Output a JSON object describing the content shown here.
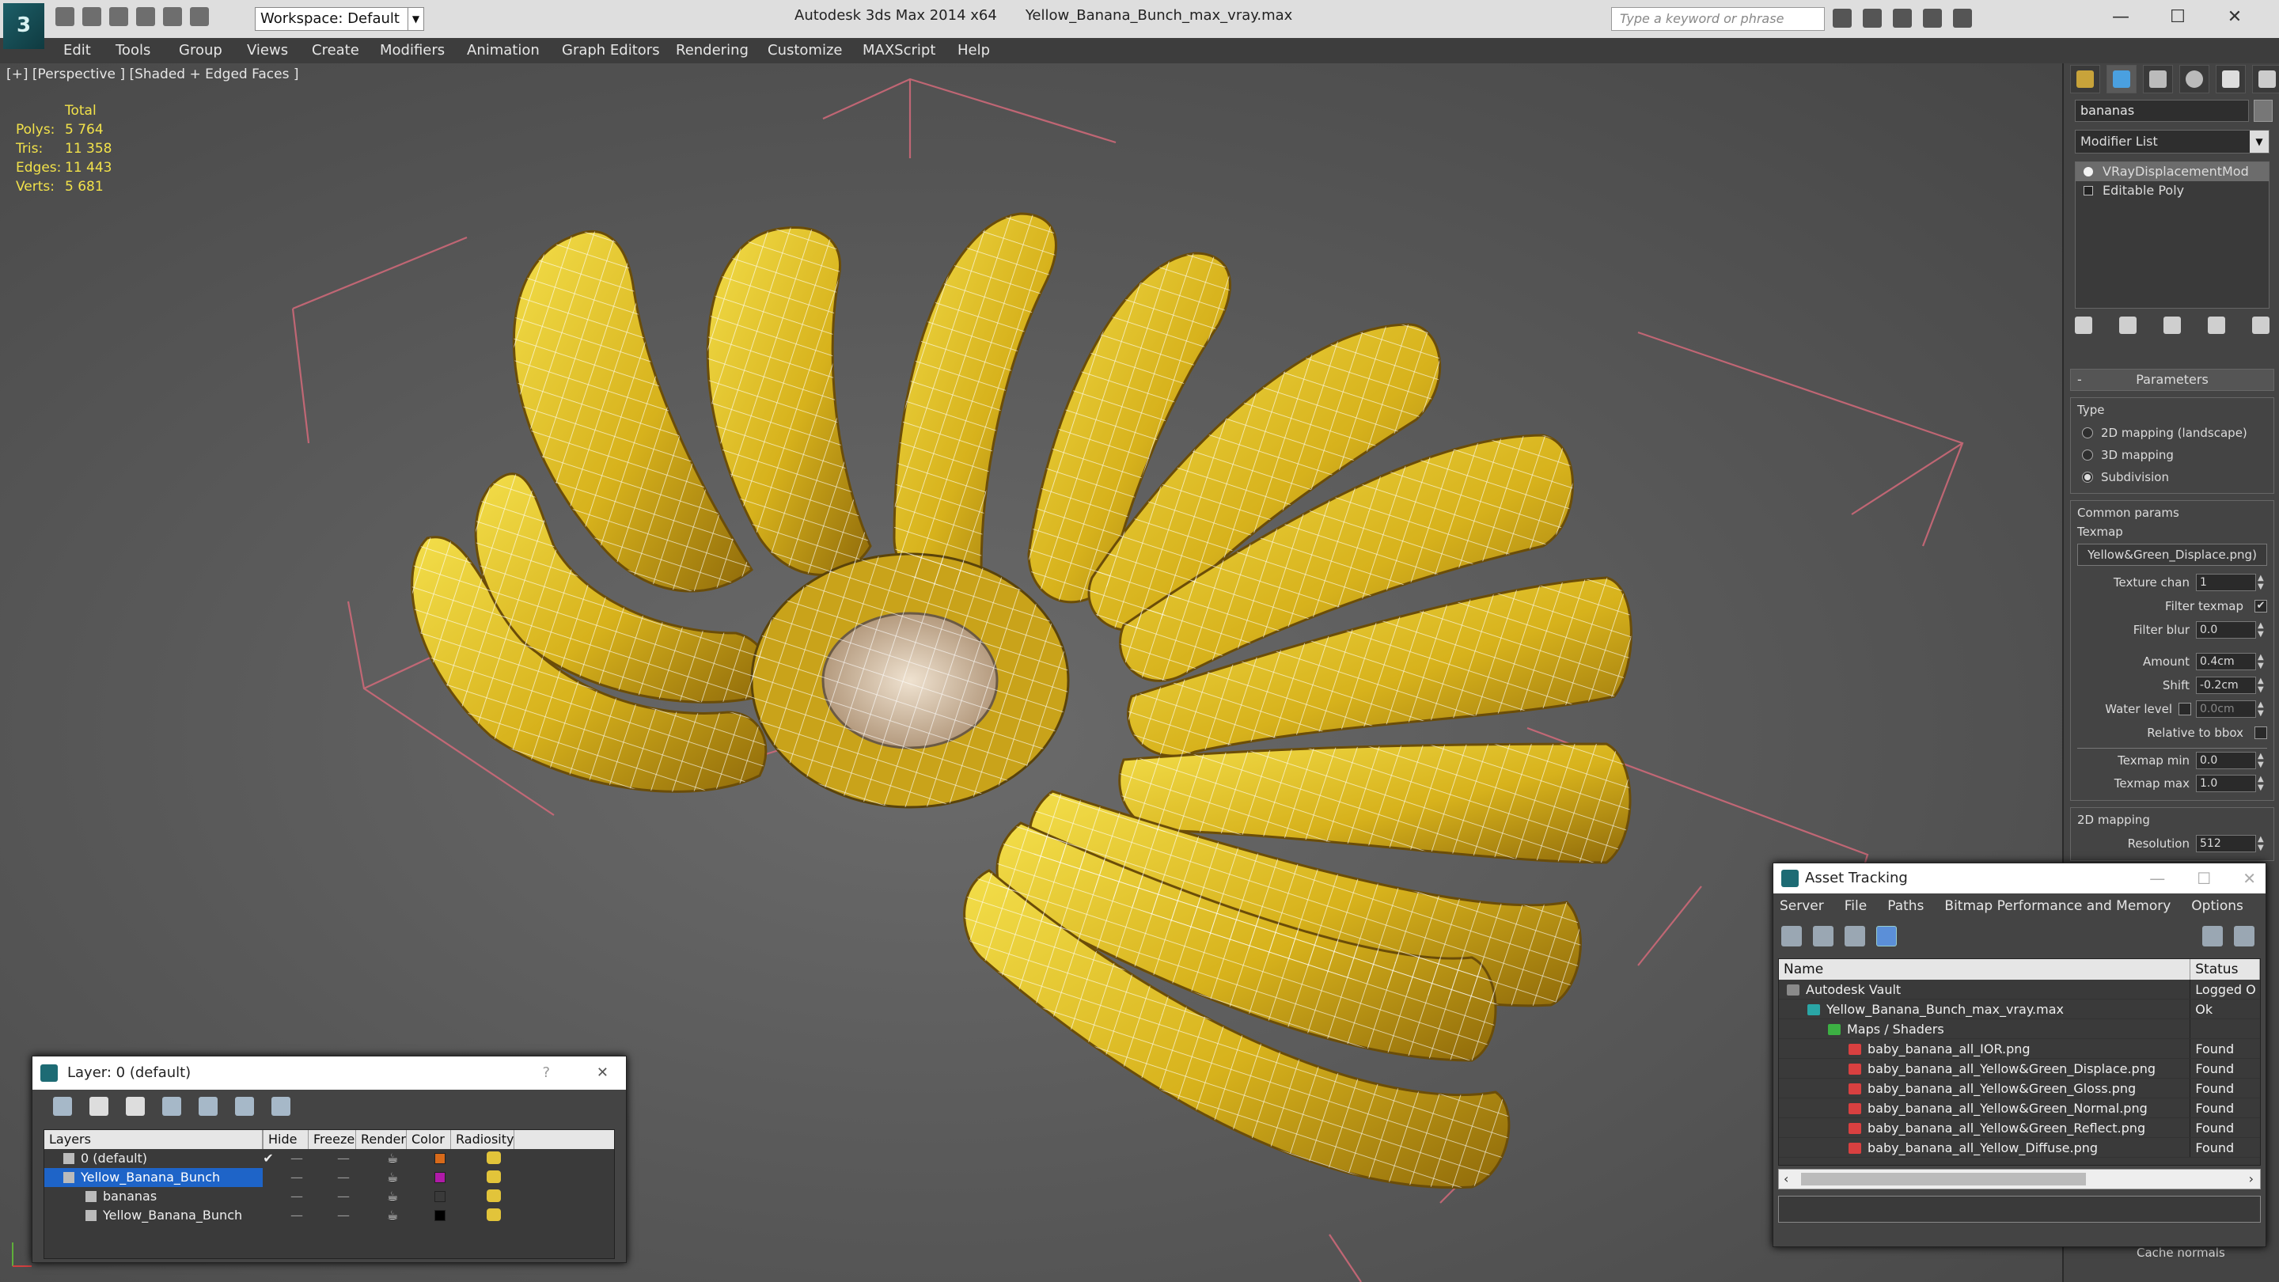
{
  "app": {
    "title": "Autodesk 3ds Max  2014 x64",
    "file": "Yellow_Banana_Bunch_max_vray.max",
    "workspace": "Workspace: Default",
    "search_placeholder": "Type a keyword or phrase"
  },
  "menu": [
    "Edit",
    "Tools",
    "Group",
    "Views",
    "Create",
    "Modifiers",
    "Animation",
    "Graph Editors",
    "Rendering",
    "Customize",
    "MAXScript",
    "Help"
  ],
  "viewport": {
    "label": "[+] [Perspective ] [Shaded + Edged Faces ]",
    "stats_header": "Total",
    "stats": [
      {
        "k": "Polys:",
        "v": "5 764"
      },
      {
        "k": "Tris:",
        "v": "11 358"
      },
      {
        "k": "Edges:",
        "v": "11 443"
      },
      {
        "k": "Verts:",
        "v": "5 681"
      }
    ]
  },
  "command_panel": {
    "object_name": "bananas",
    "modifier_list": "Modifier List",
    "stack": [
      "VRayDisplacementMod",
      "Editable Poly"
    ],
    "rollout": "Parameters",
    "type_label": "Type",
    "type_options": [
      "2D mapping (landscape)",
      "3D mapping",
      "Subdivision"
    ],
    "type_selected": 2,
    "common_label": "Common params",
    "texmap_label": "Texmap",
    "texmap_value": "Yellow&Green_Displace.png)",
    "texture_chan": {
      "label": "Texture chan",
      "value": "1"
    },
    "filter_texmap": {
      "label": "Filter texmap",
      "checked": "✔"
    },
    "filter_blur": {
      "label": "Filter blur",
      "value": "0.0"
    },
    "amount": {
      "label": "Amount",
      "value": "0.4cm"
    },
    "shift": {
      "label": "Shift",
      "value": "-0.2cm"
    },
    "water_level": {
      "label": "Water level",
      "value": "0.0cm"
    },
    "relative_bbox": {
      "label": "Relative to bbox"
    },
    "texmap_min": {
      "label": "Texmap min",
      "value": "0.0"
    },
    "texmap_max": {
      "label": "Texmap max",
      "value": "1.0"
    },
    "mapping_2d": "2D mapping",
    "resolution": {
      "label": "Resolution",
      "value": "512"
    },
    "cache_normals": "Cache normals"
  },
  "layer_dialog": {
    "title": "Layer: 0 (default)",
    "help": "?",
    "close": "✕",
    "columns": [
      "Layers",
      "Hide",
      "Freeze",
      "Render",
      "Color",
      "Radiosity"
    ],
    "rows": [
      {
        "name": "0 (default)",
        "mark": "✔",
        "color": "#d86a1a",
        "indent": 1,
        "selected": false
      },
      {
        "name": "Yellow_Banana_Bunch",
        "mark": "",
        "color": "#b01aa8",
        "indent": 1,
        "selected": true
      },
      {
        "name": "bananas",
        "mark": "",
        "color": "#3a3a3a",
        "indent": 2,
        "selected": false
      },
      {
        "name": "Yellow_Banana_Bunch",
        "mark": "",
        "color": "#000000",
        "indent": 2,
        "selected": false
      }
    ]
  },
  "asset_dialog": {
    "title": "Asset Tracking",
    "menu": [
      "Server",
      "File",
      "Paths",
      "Bitmap Performance and Memory",
      "Options"
    ],
    "col_name": "Name",
    "col_status": "Status",
    "rows": [
      {
        "name": "Autodesk Vault",
        "status": "Logged O",
        "indent": 1,
        "icon": "#8a8a8a"
      },
      {
        "name": "Yellow_Banana_Bunch_max_vray.max",
        "status": "Ok",
        "indent": 2,
        "icon": "#2aa6a6"
      },
      {
        "name": "Maps / Shaders",
        "status": "",
        "indent": 3,
        "icon": "#3cb043"
      },
      {
        "name": "baby_banana_all_IOR.png",
        "status": "Found",
        "indent": 4,
        "icon": "#d94040"
      },
      {
        "name": "baby_banana_all_Yellow&Green_Displace.png",
        "status": "Found",
        "indent": 4,
        "icon": "#d94040"
      },
      {
        "name": "baby_banana_all_Yellow&Green_Gloss.png",
        "status": "Found",
        "indent": 4,
        "icon": "#d94040"
      },
      {
        "name": "baby_banana_all_Yellow&Green_Normal.png",
        "status": "Found",
        "indent": 4,
        "icon": "#d94040"
      },
      {
        "name": "baby_banana_all_Yellow&Green_Reflect.png",
        "status": "Found",
        "indent": 4,
        "icon": "#d94040"
      },
      {
        "name": "baby_banana_all_Yellow_Diffuse.png",
        "status": "Found",
        "indent": 4,
        "icon": "#d94040"
      }
    ]
  }
}
